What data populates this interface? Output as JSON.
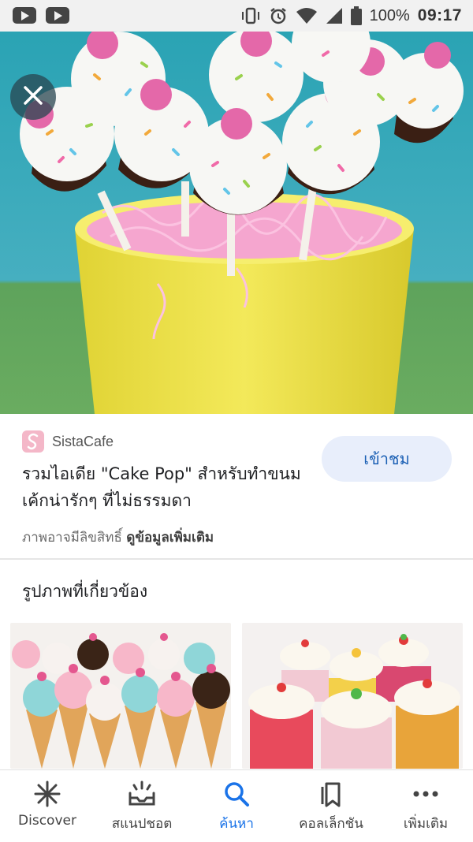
{
  "status_bar": {
    "battery": "100%",
    "time": "09:17"
  },
  "source": {
    "name": "SistaCafe"
  },
  "result": {
    "title": "รวมไอเดีย \"Cake Pop\" สำหรับทำขนม เค้กน่ารักๆ ที่ไม่ธรรมดา",
    "visit_label": "เข้าชม",
    "rights_text": "ภาพอาจมีลิขสิทธิ์",
    "more_info_link": "ดูข้อมูลเพิ่มเติม"
  },
  "related": {
    "heading": "รูปภาพที่เกี่ยวข้อง"
  },
  "bottom_nav": {
    "items": [
      {
        "label": "Discover",
        "icon": "asterisk-icon"
      },
      {
        "label": "สแนปชอต",
        "icon": "snapshot-icon"
      },
      {
        "label": "ค้นหา",
        "icon": "search-icon"
      },
      {
        "label": "คอลเล็กชัน",
        "icon": "collections-icon"
      },
      {
        "label": "เพิ่มเติม",
        "icon": "more-dots-icon"
      }
    ]
  },
  "colors": {
    "accent": "#1a73e8",
    "visit_button_bg": "#e8eefb"
  }
}
